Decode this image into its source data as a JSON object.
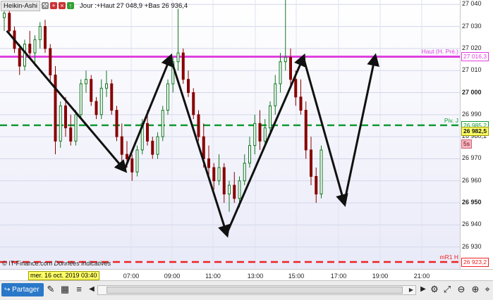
{
  "header": {
    "indicator_name": "Heikin-Ashi",
    "session_info": "Jour :+Haut 27 048,9 +Bas 26 936,4"
  },
  "footer": {
    "copyright": "© IT-Finance.com",
    "disclaimer": "Données indicatives",
    "date_badge": "mer. 16 oct. 2019 03:40"
  },
  "toolbar": {
    "share_label": "Partager"
  },
  "colors": {
    "haut": "#e040e0",
    "pivot": "#119933",
    "mr1": "#ee2222",
    "last_price_bg": "#ffff66",
    "down_candle": "#880000",
    "up_candle": "#117722"
  },
  "chart_data": {
    "type": "candlestick",
    "ylim": [
      26920,
      27042
    ],
    "yticks": [
      {
        "value": 27040,
        "label": "27 040",
        "major": false
      },
      {
        "value": 27030,
        "label": "27 030",
        "major": false
      },
      {
        "value": 27020,
        "label": "27 020",
        "major": false
      },
      {
        "value": 27010,
        "label": "27 010",
        "major": false
      },
      {
        "value": 27000,
        "label": "27 000",
        "major": true
      },
      {
        "value": 26990,
        "label": "26 990",
        "major": false
      },
      {
        "value": 26980,
        "label": "26 980,1",
        "major": false
      },
      {
        "value": 26970,
        "label": "26 970",
        "major": false
      },
      {
        "value": 26960,
        "label": "26 960",
        "major": false
      },
      {
        "value": 26950,
        "label": "26 950",
        "major": true
      },
      {
        "value": 26940,
        "label": "26 940",
        "major": false
      },
      {
        "value": 26930,
        "label": "26 930",
        "major": false
      }
    ],
    "xticks": [
      "07:00",
      "09:00",
      "11:00",
      "13:00",
      "15:00",
      "17:00",
      "19:00",
      "21:00"
    ],
    "levels": [
      {
        "name": "Haut (H. Pré.)",
        "value": 27016.3,
        "badge": "27 016,3",
        "color": "#e040e0",
        "style": "solid"
      },
      {
        "name": "Piv. J",
        "value": 26985.2,
        "badge": "26 985,2",
        "color": "#119933",
        "style": "dashed"
      },
      {
        "name": "mR1 H",
        "value": 26923.2,
        "badge": "26 923,2",
        "color": "#ee2222",
        "style": "dashed"
      }
    ],
    "last_price": {
      "value": 26982.5,
      "label": "26 982,5"
    },
    "timeframe_badge": "5s",
    "candles": [
      {
        "o": 27034,
        "h": 27038,
        "l": 27028,
        "c": 27036
      },
      {
        "o": 27036,
        "h": 27037,
        "l": 27026,
        "c": 27028
      },
      {
        "o": 27028,
        "h": 27030,
        "l": 27018,
        "c": 27020
      },
      {
        "o": 27020,
        "h": 27022,
        "l": 27008,
        "c": 27012
      },
      {
        "o": 27012,
        "h": 27024,
        "l": 27010,
        "c": 27022
      },
      {
        "o": 27022,
        "h": 27028,
        "l": 27016,
        "c": 27018
      },
      {
        "o": 27018,
        "h": 27026,
        "l": 27012,
        "c": 27024
      },
      {
        "o": 27024,
        "h": 27032,
        "l": 27020,
        "c": 27030
      },
      {
        "o": 27030,
        "h": 27033,
        "l": 27018,
        "c": 27020
      },
      {
        "o": 27020,
        "h": 27022,
        "l": 27005,
        "c": 27008
      },
      {
        "o": 27008,
        "h": 27012,
        "l": 26972,
        "c": 26978
      },
      {
        "o": 26978,
        "h": 26996,
        "l": 26975,
        "c": 26994
      },
      {
        "o": 26994,
        "h": 26998,
        "l": 26980,
        "c": 26984
      },
      {
        "o": 26984,
        "h": 26990,
        "l": 26976,
        "c": 26978
      },
      {
        "o": 26978,
        "h": 26992,
        "l": 26976,
        "c": 26990
      },
      {
        "o": 26990,
        "h": 27006,
        "l": 26988,
        "c": 27004
      },
      {
        "o": 27004,
        "h": 27010,
        "l": 27000,
        "c": 27006
      },
      {
        "o": 27006,
        "h": 27008,
        "l": 26994,
        "c": 26996
      },
      {
        "o": 26996,
        "h": 26998,
        "l": 26988,
        "c": 26990
      },
      {
        "o": 26990,
        "h": 27006,
        "l": 26988,
        "c": 27002
      },
      {
        "o": 27002,
        "h": 27010,
        "l": 26998,
        "c": 27004
      },
      {
        "o": 27004,
        "h": 27006,
        "l": 26990,
        "c": 26992
      },
      {
        "o": 26992,
        "h": 26994,
        "l": 26978,
        "c": 26980
      },
      {
        "o": 26980,
        "h": 26986,
        "l": 26968,
        "c": 26972
      },
      {
        "o": 26972,
        "h": 26978,
        "l": 26966,
        "c": 26970
      },
      {
        "o": 26970,
        "h": 26972,
        "l": 26960,
        "c": 26964
      },
      {
        "o": 26964,
        "h": 26976,
        "l": 26962,
        "c": 26974
      },
      {
        "o": 26974,
        "h": 26988,
        "l": 26972,
        "c": 26986
      },
      {
        "o": 26986,
        "h": 26992,
        "l": 26976,
        "c": 26978
      },
      {
        "o": 26978,
        "h": 26980,
        "l": 26970,
        "c": 26972
      },
      {
        "o": 26972,
        "h": 26982,
        "l": 26970,
        "c": 26980
      },
      {
        "o": 26980,
        "h": 26994,
        "l": 26978,
        "c": 26992
      },
      {
        "o": 26992,
        "h": 27006,
        "l": 26990,
        "c": 27004
      },
      {
        "o": 27004,
        "h": 27016,
        "l": 27000,
        "c": 27014
      },
      {
        "o": 27014,
        "h": 27038,
        "l": 27010,
        "c": 27018
      },
      {
        "o": 27018,
        "h": 27020,
        "l": 27004,
        "c": 27006
      },
      {
        "o": 27006,
        "h": 27010,
        "l": 26998,
        "c": 27000
      },
      {
        "o": 27000,
        "h": 27002,
        "l": 26988,
        "c": 26990
      },
      {
        "o": 26990,
        "h": 26992,
        "l": 26978,
        "c": 26980
      },
      {
        "o": 26980,
        "h": 26986,
        "l": 26966,
        "c": 26970
      },
      {
        "o": 26970,
        "h": 26976,
        "l": 26962,
        "c": 26966
      },
      {
        "o": 26966,
        "h": 26968,
        "l": 26956,
        "c": 26960
      },
      {
        "o": 26960,
        "h": 26972,
        "l": 26958,
        "c": 26966
      },
      {
        "o": 26966,
        "h": 26968,
        "l": 26950,
        "c": 26954
      },
      {
        "o": 26954,
        "h": 26960,
        "l": 26946,
        "c": 26958
      },
      {
        "o": 26958,
        "h": 26964,
        "l": 26950,
        "c": 26952
      },
      {
        "o": 26952,
        "h": 26962,
        "l": 26948,
        "c": 26960
      },
      {
        "o": 26960,
        "h": 26972,
        "l": 26958,
        "c": 26968
      },
      {
        "o": 26968,
        "h": 26980,
        "l": 26966,
        "c": 26976
      },
      {
        "o": 26976,
        "h": 26990,
        "l": 26972,
        "c": 26986
      },
      {
        "o": 26986,
        "h": 26992,
        "l": 26974,
        "c": 26978
      },
      {
        "o": 26978,
        "h": 26988,
        "l": 26976,
        "c": 26984
      },
      {
        "o": 26984,
        "h": 26996,
        "l": 26982,
        "c": 26994
      },
      {
        "o": 26994,
        "h": 27008,
        "l": 26990,
        "c": 27004
      },
      {
        "o": 27004,
        "h": 27018,
        "l": 27000,
        "c": 27014
      },
      {
        "o": 27014,
        "h": 27042,
        "l": 27010,
        "c": 27016
      },
      {
        "o": 27016,
        "h": 27020,
        "l": 27002,
        "c": 27006
      },
      {
        "o": 27006,
        "h": 27010,
        "l": 26994,
        "c": 26998
      },
      {
        "o": 26998,
        "h": 27006,
        "l": 26990,
        "c": 26992
      },
      {
        "o": 26992,
        "h": 26996,
        "l": 26970,
        "c": 26974
      },
      {
        "o": 26974,
        "h": 26980,
        "l": 26958,
        "c": 26962
      },
      {
        "o": 26962,
        "h": 26966,
        "l": 26950,
        "c": 26954
      },
      {
        "o": 26954,
        "h": 26976,
        "l": 26952,
        "c": 26974
      }
    ],
    "arrows": [
      {
        "from": [
          0.5,
          27028
        ],
        "to": [
          23.5,
          26965
        ]
      },
      {
        "from": [
          23.5,
          26965
        ],
        "to": [
          32.5,
          27016
        ]
      },
      {
        "from": [
          32.5,
          27016
        ],
        "to": [
          43.5,
          26936
        ]
      },
      {
        "from": [
          43.5,
          26936
        ],
        "to": [
          58.5,
          27016
        ]
      },
      {
        "from": [
          58.5,
          27016
        ],
        "to": [
          66.5,
          26950
        ]
      },
      {
        "from": [
          66.5,
          26950
        ],
        "to": [
          72.5,
          27016
        ]
      }
    ]
  }
}
